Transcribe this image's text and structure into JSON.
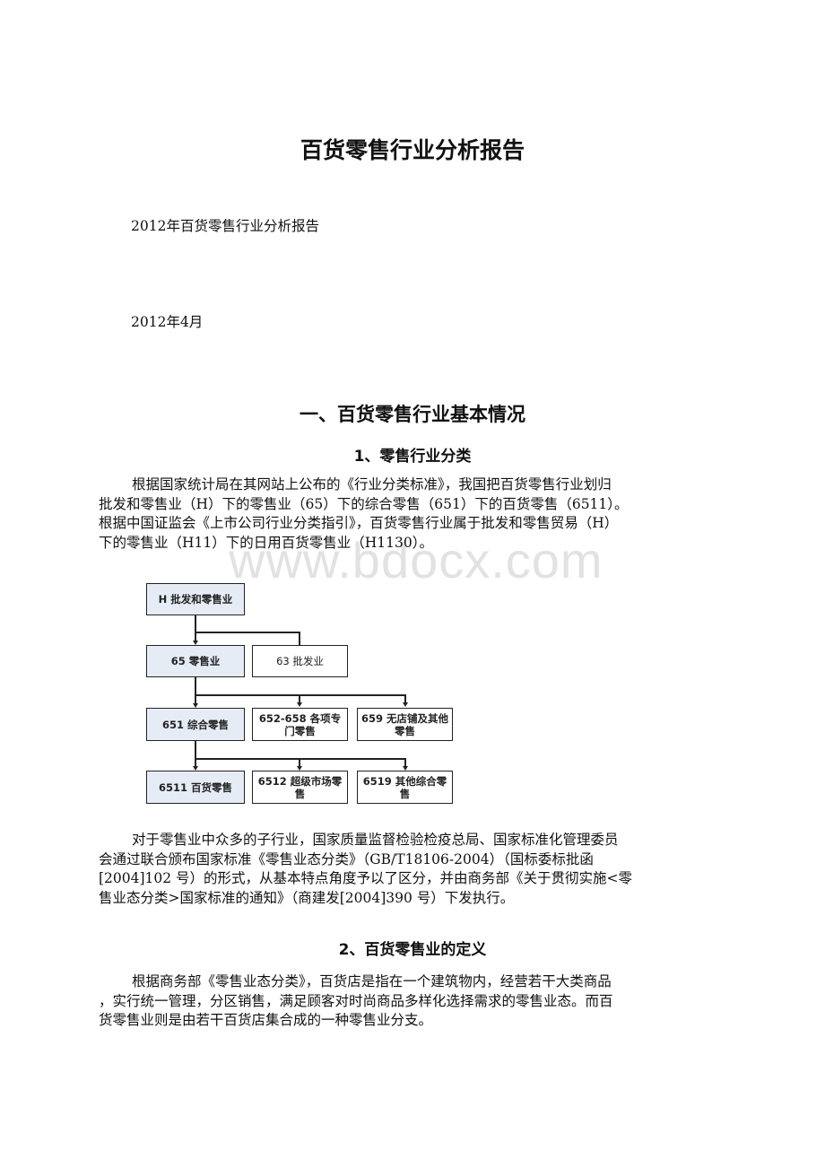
{
  "document": {
    "title": "百货零售行业分析报告",
    "subtitle": "2012年百货零售行业分析报告",
    "date": "2012年4月",
    "watermark": "www.bdocx.com"
  },
  "section1": {
    "heading": "一、百货零售行业基本情况",
    "sub1": {
      "heading": "1、零售行业分类",
      "paragraph_lines": [
        "根据国家统计局在其网站上公布的《行业分类标准》，我国把百货零售行业划归",
        "批发和零售业（H）下的零售业（65）下的综合零售（651）下的百货零售（6511）。",
        "根据中国证监会《上市公司行业分类指引》，百货零售行业属于批发和零售贸易（H）",
        "下的零售业（H11）下的日用百货零售业（H1130）。"
      ]
    },
    "diagram": {
      "nodes": {
        "h": "H 批发和零售业",
        "n65": "65 零售业",
        "n63": "63 批发业",
        "n651": "651 综合零售",
        "n652": "652-658 各项专门零售",
        "n659": "659 无店铺及其他零售",
        "n6511": "6511 百货零售",
        "n6512": "6512 超级市场零售",
        "n6519": "6519 其他综合零售"
      }
    },
    "paragraph2_lines": [
      "对于零售业中众多的子行业，国家质量监督检验检疫总局、国家标准化管理委员",
      "会通过联合颁布国家标准《零售业态分类》（GB/T18106-2004）（国标委标批函",
      "[2004]102 号）的形式，从基本特点角度予以了区分，并由商务部《关于贯彻实施<零",
      "售业态分类>国家标准的通知》（商建发[2004]390 号）下发执行。"
    ],
    "sub2": {
      "heading": "2、百货零售业的定义",
      "paragraph_lines": [
        "根据商务部《零售业态分类》，百货店是指在一个建筑物内，经营若干大类商品",
        "，实行统一管理，分区销售，满足顾客对时尚商品多样化选择需求的零售业态。而百",
        "货零售业则是由若干百货店集合成的一种零售业分支。"
      ]
    }
  }
}
